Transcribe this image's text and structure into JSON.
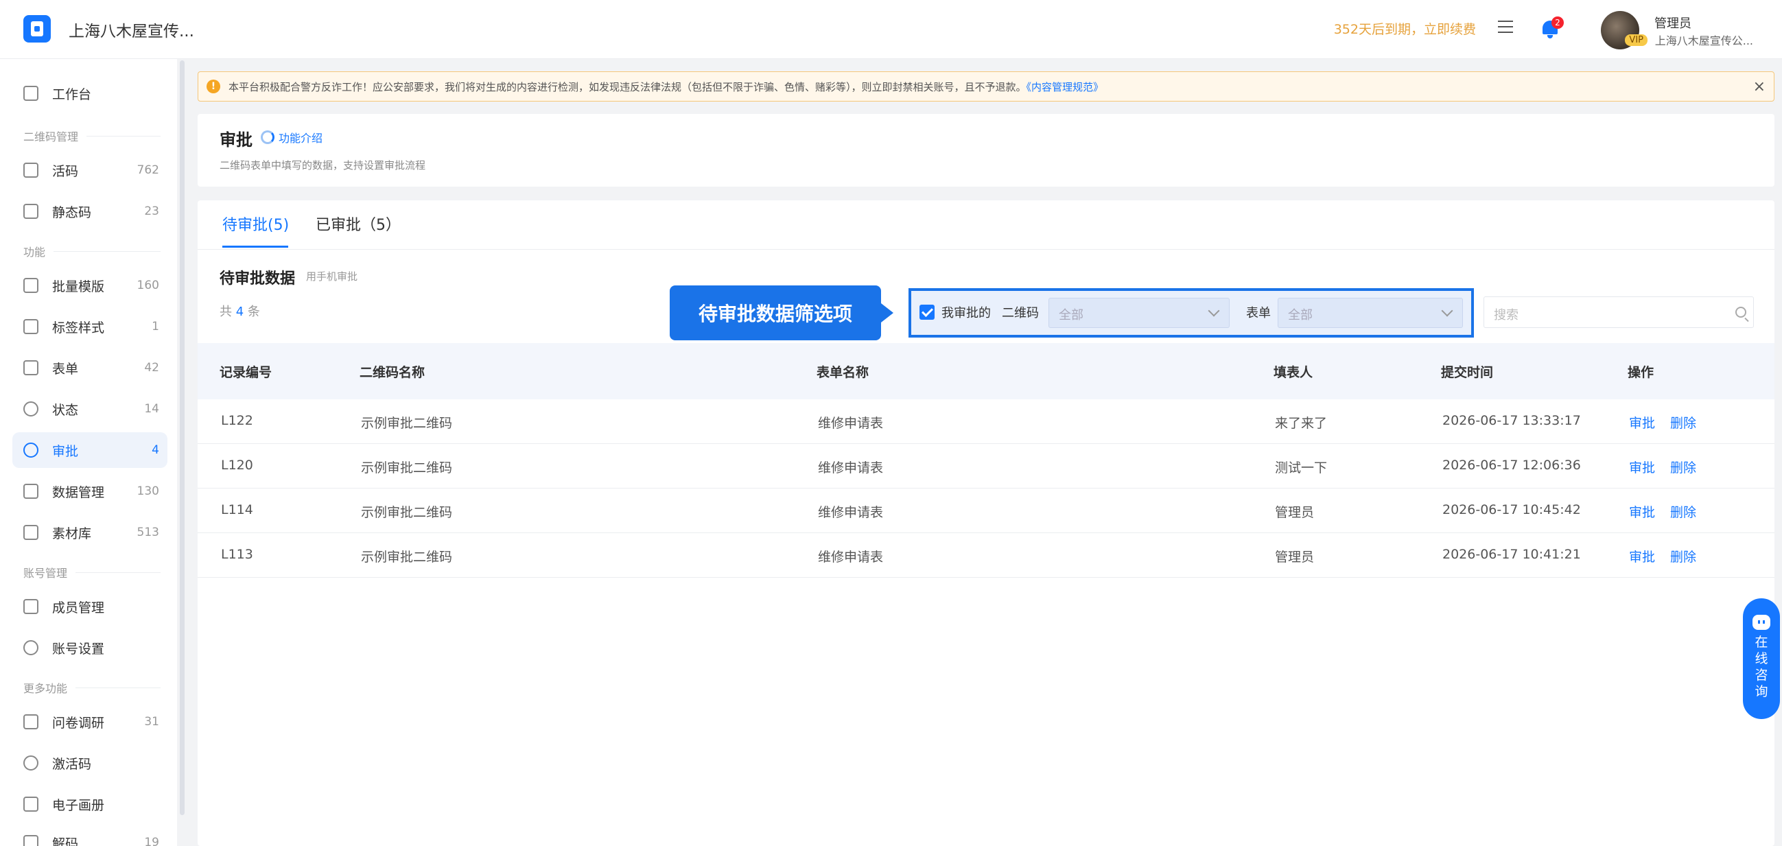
{
  "header": {
    "app_title": "上海八木屋宣传...",
    "expire_text": "352天后到期，立即续费",
    "notification_count": "2",
    "user_name": "管理员",
    "user_org": "上海八木屋宣传公...",
    "vip_label": "VIP"
  },
  "sidebar": {
    "workbench": "工作台",
    "groups": {
      "qrcode": "二维码管理",
      "features": "功能",
      "account": "账号管理",
      "more": "更多功能"
    },
    "items": [
      {
        "label": "活码",
        "count": "762"
      },
      {
        "label": "静态码",
        "count": "23"
      },
      {
        "label": "批量模版",
        "count": "160"
      },
      {
        "label": "标签样式",
        "count": "1"
      },
      {
        "label": "表单",
        "count": "42"
      },
      {
        "label": "状态",
        "count": "14"
      },
      {
        "label": "审批",
        "count": "4"
      },
      {
        "label": "数据管理",
        "count": "130"
      },
      {
        "label": "素材库",
        "count": "513"
      },
      {
        "label": "成员管理",
        "count": ""
      },
      {
        "label": "账号设置",
        "count": ""
      },
      {
        "label": "问卷调研",
        "count": "31"
      },
      {
        "label": "激活码",
        "count": ""
      },
      {
        "label": "电子画册",
        "count": ""
      },
      {
        "label": "解码",
        "count": "19"
      }
    ]
  },
  "notice": {
    "text": "本平台积极配合警方反诈工作！应公安部要求，我们将对生成的内容进行检测，如发现违反法律法规（包括但不限于诈骗、色情、赌彩等），则立即封禁相关账号，且不予退款。",
    "link": "《内容管理规范》"
  },
  "page": {
    "title": "审批",
    "intro_link": "功能介绍",
    "subtitle": "二维码表单中填写的数据，支持设置审批流程"
  },
  "tabs": [
    {
      "label": "待审批(5)"
    },
    {
      "label": "已审批（5）"
    }
  ],
  "section": {
    "title": "待审批数据",
    "hint": "用手机审批",
    "total_prefix": "共",
    "total_count": "4",
    "total_suffix": "条"
  },
  "callout": "待审批数据筛选项",
  "filters": {
    "mine_label": "我审批的",
    "qrcode_label": "二维码",
    "qrcode_value": "全部",
    "form_label": "表单",
    "form_value": "全部",
    "search_placeholder": "搜索"
  },
  "table": {
    "columns": [
      "记录编号",
      "二维码名称",
      "表单名称",
      "填表人",
      "提交时间",
      "操作"
    ],
    "rows": [
      {
        "id": "L122",
        "qrcode": "示例审批二维码",
        "form": "维修申请表",
        "filler": "来了来了",
        "time": "2026-06-17 13:33:17"
      },
      {
        "id": "L120",
        "qrcode": "示例审批二维码",
        "form": "维修申请表",
        "filler": "测试一下",
        "time": "2026-06-17 12:06:36"
      },
      {
        "id": "L114",
        "qrcode": "示例审批二维码",
        "form": "维修申请表",
        "filler": "管理员",
        "time": "2026-06-17 10:45:42"
      },
      {
        "id": "L113",
        "qrcode": "示例审批二维码",
        "form": "维修申请表",
        "filler": "管理员",
        "time": "2026-06-17 10:41:21"
      }
    ],
    "action_approve": "审批",
    "action_delete": "删除"
  },
  "consult": "在线咨询",
  "colors": {
    "primary": "#1677ff",
    "warning": "#e6a23c",
    "danger": "#f5222d"
  }
}
